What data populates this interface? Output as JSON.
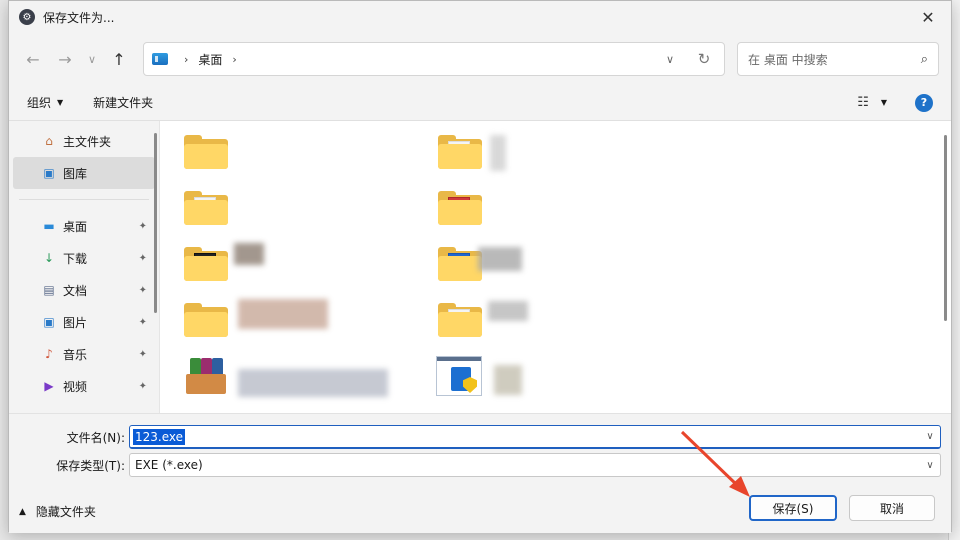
{
  "window": {
    "title": "保存文件为...",
    "close": "✕"
  },
  "nav": {
    "back": "←",
    "forward": "→",
    "recent": "∨",
    "up": "↑"
  },
  "address": {
    "crumb": "桌面",
    "sep": "›",
    "drop": "∨",
    "refresh": "↻"
  },
  "search": {
    "placeholder": "在 桌面 中搜索",
    "icon": "⌕"
  },
  "toolbar": {
    "organize": "组织",
    "new_folder": "新建文件夹",
    "help": "?"
  },
  "sidebar": {
    "items": [
      {
        "label": "主文件夹",
        "icon": "home-icon",
        "glyph": "⌂"
      },
      {
        "label": "图库",
        "icon": "gallery-icon",
        "glyph": "▣"
      }
    ],
    "pinned": [
      {
        "label": "桌面",
        "icon": "desktop-icon",
        "glyph": "▬"
      },
      {
        "label": "下载",
        "icon": "download-icon",
        "glyph": "↓"
      },
      {
        "label": "文档",
        "icon": "document-icon",
        "glyph": "▤"
      },
      {
        "label": "图片",
        "icon": "picture-icon",
        "glyph": "▣"
      },
      {
        "label": "音乐",
        "icon": "music-icon",
        "glyph": "♪"
      },
      {
        "label": "视频",
        "icon": "video-icon",
        "glyph": "▶"
      }
    ],
    "pin_glyph": "📌"
  },
  "form": {
    "filename_label": "文件名(N):",
    "filename_value": "123.exe",
    "filetype_label": "保存类型(T):",
    "filetype_value": "EXE (*.exe)",
    "drop": "∨"
  },
  "footer": {
    "hide_folders": "隐藏文件夹",
    "save": "保存(S)",
    "cancel": "取消"
  },
  "colors": {
    "accent": "#2066c8",
    "arrow": "#e8452c",
    "folder": "#ffd766"
  }
}
